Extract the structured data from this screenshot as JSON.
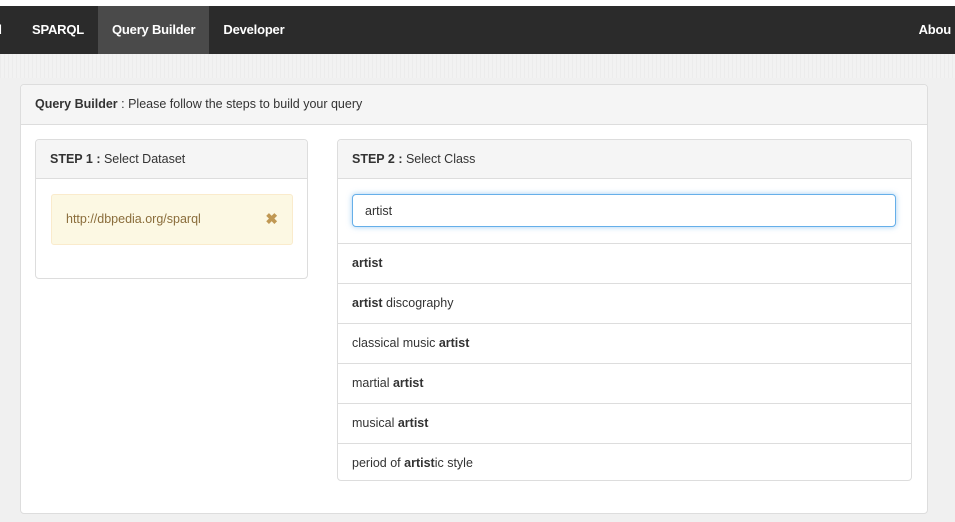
{
  "navbar": {
    "items": [
      {
        "label": "d"
      },
      {
        "label": "SPARQL"
      },
      {
        "label": "Query Builder",
        "active": true
      },
      {
        "label": "Developer"
      }
    ],
    "right_label": "Abou"
  },
  "main": {
    "title_bold": "Query Builder",
    "title_rest": " : Please follow the steps to build your query"
  },
  "step1": {
    "bold": "STEP 1 :",
    "rest": " Select Dataset",
    "dataset": "http://dbpedia.org/sparql",
    "remove_icon": "close-icon"
  },
  "step2": {
    "bold": "STEP 2 :",
    "rest": " Select Class",
    "search_value": "artist",
    "results": [
      {
        "pre": "",
        "bold": "artist",
        "post": ""
      },
      {
        "pre": "",
        "bold": "artist",
        "post": " discography"
      },
      {
        "pre": "classical music ",
        "bold": "artist",
        "post": ""
      },
      {
        "pre": "martial ",
        "bold": "artist",
        "post": ""
      },
      {
        "pre": "musical ",
        "bold": "artist",
        "post": ""
      },
      {
        "pre": "period of ",
        "bold": "artist",
        "post": "ic style"
      }
    ]
  },
  "colors": {
    "navbar_bg": "#2b2b2b",
    "navbar_active": "#4a4a4a",
    "dataset_bg": "#fcf8e3",
    "dataset_text": "#8a6d3b",
    "focus_border": "#66afe9"
  }
}
